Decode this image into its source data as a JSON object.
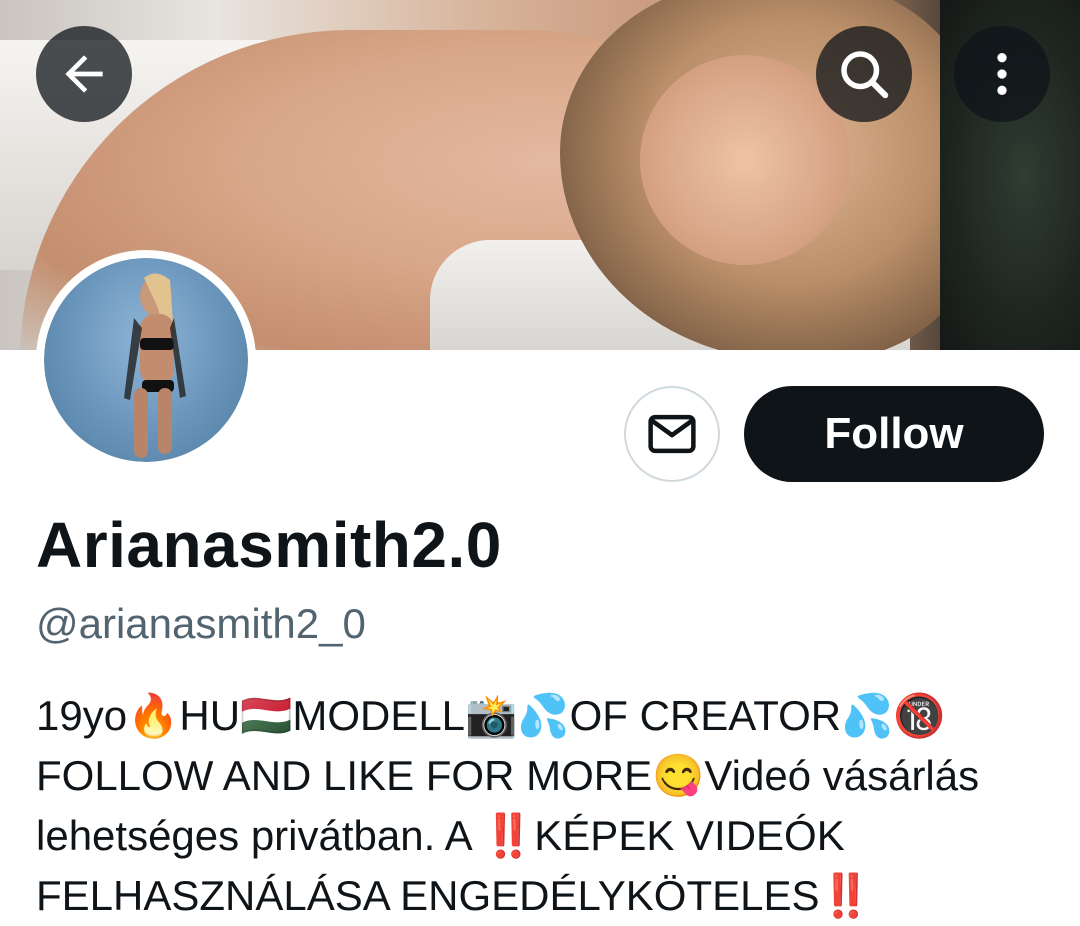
{
  "header": {
    "back_icon": "arrow-left-icon",
    "search_icon": "search-icon",
    "more_icon": "more-vertical-icon"
  },
  "profile": {
    "display_name": "Arianasmith2.0",
    "handle": "@arianasmith2_0",
    "follow_label": "Follow",
    "message_icon": "mail-icon",
    "bio_lines": [
      "19yo🔥HU🇭🇺MODELL📸💦OF CREATOR💦🔞",
      "FOLLOW AND LIKE FOR MORE😋Videó vásárlás",
      "lehetséges privátban. A ‼️KÉPEK VIDEÓK",
      "FELHASZNÁLÁSA ENGEDÉLYKÖTELES‼️"
    ]
  },
  "colors": {
    "primary_text": "#0f1419",
    "secondary_text": "#536471",
    "button_dark": "#0f1419",
    "border": "#cfd9de"
  }
}
